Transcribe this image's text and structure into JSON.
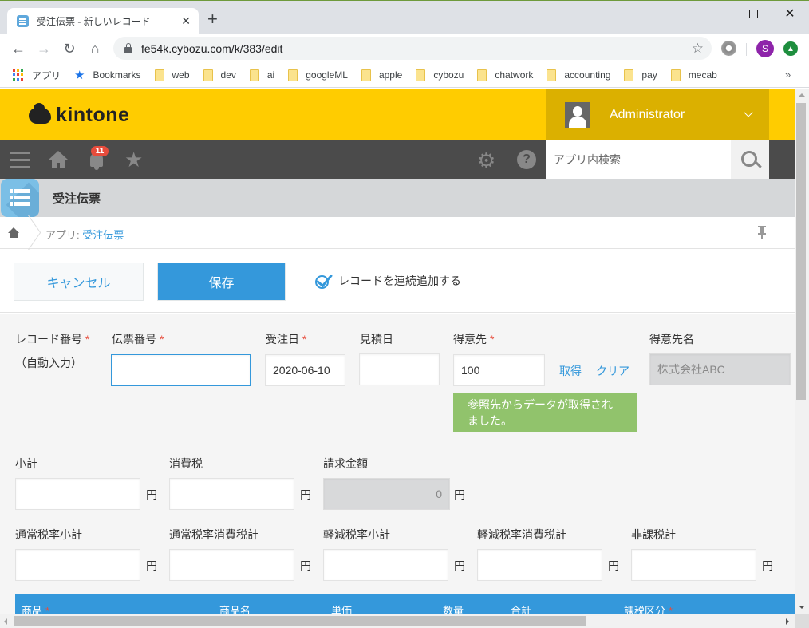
{
  "browser": {
    "tab_title": "受注伝票 - 新しいレコード",
    "url": "fe54k.cybozu.com/k/383/edit",
    "profile_initial": "S",
    "bookmarks": [
      {
        "label": "アプリ",
        "icon": "apps-grid-icon"
      },
      {
        "label": "Bookmarks",
        "icon": "star-icon"
      },
      {
        "label": "web",
        "icon": "folder-icon"
      },
      {
        "label": "dev",
        "icon": "folder-icon"
      },
      {
        "label": "ai",
        "icon": "folder-icon"
      },
      {
        "label": "googleML",
        "icon": "folder-icon"
      },
      {
        "label": "apple",
        "icon": "folder-icon"
      },
      {
        "label": "cybozu",
        "icon": "folder-icon"
      },
      {
        "label": "chatwork",
        "icon": "folder-icon"
      },
      {
        "label": "accounting",
        "icon": "folder-icon"
      },
      {
        "label": "pay",
        "icon": "folder-icon"
      },
      {
        "label": "mecab",
        "icon": "folder-icon"
      }
    ],
    "more_bookmarks": "»"
  },
  "kintone": {
    "logo_text": "kintone",
    "user_name": "Administrator",
    "notification_count": "11",
    "search_placeholder": "アプリ内検索",
    "help_glyph": "?",
    "app_title": "受注伝票",
    "breadcrumb_prefix": "アプリ: ",
    "breadcrumb_app": "受注伝票",
    "colors": {
      "header": "#ffcc00",
      "nav": "#4b4b4b",
      "accent": "#3498db",
      "success": "#91c36c",
      "required": "#e74c3c"
    }
  },
  "actions": {
    "cancel_label": "キャンセル",
    "save_label": "保存",
    "continuous_add_label": "レコードを連続追加する",
    "continuous_add_checked": true
  },
  "form": {
    "record_number": {
      "label": "レコード番号",
      "required": "*",
      "value": "（自動入力）"
    },
    "slip_number": {
      "label": "伝票番号",
      "required": "*",
      "value": ""
    },
    "order_date": {
      "label": "受注日",
      "required": "*",
      "value": "2020-06-10"
    },
    "estimate_date": {
      "label": "見積日",
      "value": ""
    },
    "customer": {
      "label": "得意先",
      "required": "*",
      "value": "100",
      "fetch_label": "取得",
      "clear_label": "クリア"
    },
    "customer_name": {
      "label": "得意先名",
      "value": "株式会社ABC"
    },
    "lookup_notice": "参照先からデータが取得されました。",
    "currency_unit": "円",
    "subtotal": {
      "label": "小計",
      "value": ""
    },
    "consumption_tax": {
      "label": "消費税",
      "value": ""
    },
    "billing_amount": {
      "label": "請求金額",
      "value": "0"
    },
    "standard_rate_subtotal": {
      "label": "通常税率小計",
      "value": ""
    },
    "standard_rate_tax": {
      "label": "通常税率消費税計",
      "value": ""
    },
    "reduced_rate_subtotal": {
      "label": "軽減税率小計",
      "value": ""
    },
    "reduced_rate_tax": {
      "label": "軽減税率消費税計",
      "value": ""
    },
    "tax_exempt_total": {
      "label": "非課税計",
      "value": ""
    },
    "subtable_headers": [
      {
        "label": "商品",
        "required": "*"
      },
      {
        "label": "商品名"
      },
      {
        "label": "単価"
      },
      {
        "label": "数量"
      },
      {
        "label": "合計"
      },
      {
        "label": "課税区分",
        "required": "*"
      }
    ]
  }
}
